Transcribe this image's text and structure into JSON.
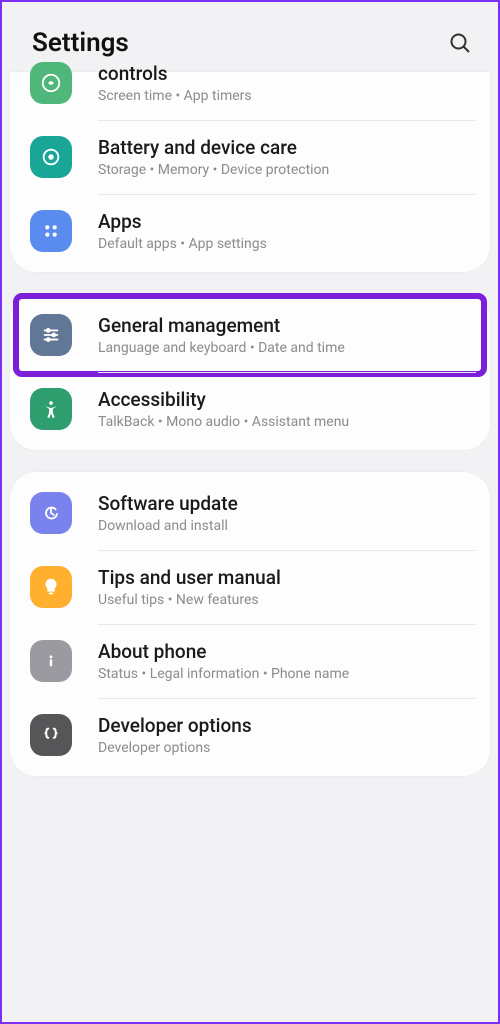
{
  "header": {
    "title": "Settings"
  },
  "groups": [
    {
      "items": [
        {
          "title": "controls",
          "sub": "Screen time  •  App timers"
        },
        {
          "title": "Battery and device care",
          "sub": "Storage  •  Memory  •  Device protection"
        },
        {
          "title": "Apps",
          "sub": "Default apps  •  App settings"
        }
      ]
    },
    {
      "items": [
        {
          "title": "General management",
          "sub": "Language and keyboard  •  Date and time"
        },
        {
          "title": "Accessibility",
          "sub": "TalkBack  •  Mono audio  •  Assistant menu"
        }
      ]
    },
    {
      "items": [
        {
          "title": "Software update",
          "sub": "Download and install"
        },
        {
          "title": "Tips and user manual",
          "sub": "Useful tips  •  New features"
        },
        {
          "title": "About phone",
          "sub": "Status  •  Legal information  •  Phone name"
        },
        {
          "title": "Developer options",
          "sub": "Developer options"
        }
      ]
    }
  ]
}
